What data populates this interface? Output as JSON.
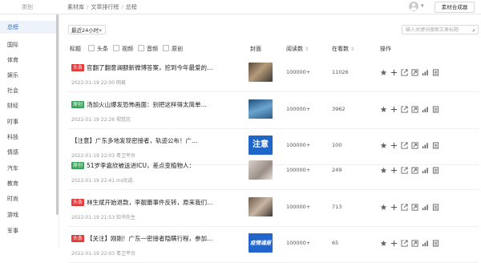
{
  "topbar": {
    "brand_label": "类别",
    "breadcrumbs": [
      "素材库",
      "文章排行榜",
      "总榜"
    ],
    "user_dropdown_arrow": "▾",
    "generator_button": "素材合成器"
  },
  "sidebar": {
    "items": [
      "总榜",
      "国际",
      "体育",
      "娱乐",
      "社会",
      "财经",
      "时事",
      "科技",
      "情感",
      "汽车",
      "教育",
      "时尚",
      "游戏",
      "军事"
    ],
    "active_index": 0
  },
  "filters": {
    "time_range": "最近24小时",
    "search_placeholder": "输入关键词搜索文章标题"
  },
  "table": {
    "headers": {
      "title": "标题",
      "filter_headline": "头条",
      "filter_video": "视频",
      "filter_audio": "音频",
      "filter_original": "原创",
      "cover": "封面",
      "reads": "阅读数",
      "clicks": "在看数",
      "actions": "操作"
    },
    "rows": [
      {
        "tag": "头条",
        "tag_color": "#e33b3b",
        "title": "官翻了翻意澜额新微博答案，挖到今年最爱的…",
        "meta": "2022-01-19 22:00 网易",
        "reads": "100000+",
        "clicks": "11026",
        "thumb_text": ""
      },
      {
        "tag": "原创",
        "tag_color": "#3aa35b",
        "title": "汤加火山爆发恐怖画面：别把这样得太简单…",
        "meta": "2022-01-19 22:26 视觉志",
        "reads": "100000+",
        "clicks": "3962",
        "thumb_text": ""
      },
      {
        "tag": "",
        "tag_color": "",
        "title": "【注意】广东多地发现密接者，轨迹公布！广…",
        "meta": "2022-01-19 22:03 粤卫平台",
        "reads": "100000+",
        "clicks": "100",
        "thumb_text": "注意"
      },
      {
        "tag": "原创",
        "tag_color": "#3aa35b",
        "title": "51岁李嘉欣被送进ICU，差点变植物人：",
        "meta": "2022-01-19 22:41 Ins优选",
        "reads": "100000+",
        "clicks": "249",
        "thumb_text": ""
      },
      {
        "tag": "头条",
        "tag_color": "#e33b3b",
        "title": "林生斌开始退款，李靓蕾事件反转，原来我们…",
        "meta": "2022-01-19 21:53 知书先生",
        "reads": "100000+",
        "clicks": "713",
        "thumb_text": ""
      },
      {
        "tag": "头条",
        "tag_color": "#e33b3b",
        "title": "【关注】刚刚！广东一密接者隐瞒行程，参加…",
        "meta": "2022-01-19 22:03 粤卫平台",
        "reads": "100000+",
        "clicks": "65",
        "thumb_text": "疫情通报"
      }
    ],
    "action_icons": [
      "star-icon",
      "plus-icon",
      "share-icon",
      "export-icon",
      "chart-icon",
      "document-icon"
    ]
  },
  "colors": {
    "accent": "#1f6fd6",
    "tag_red": "#e33b3b",
    "tag_green": "#3aa35b"
  }
}
